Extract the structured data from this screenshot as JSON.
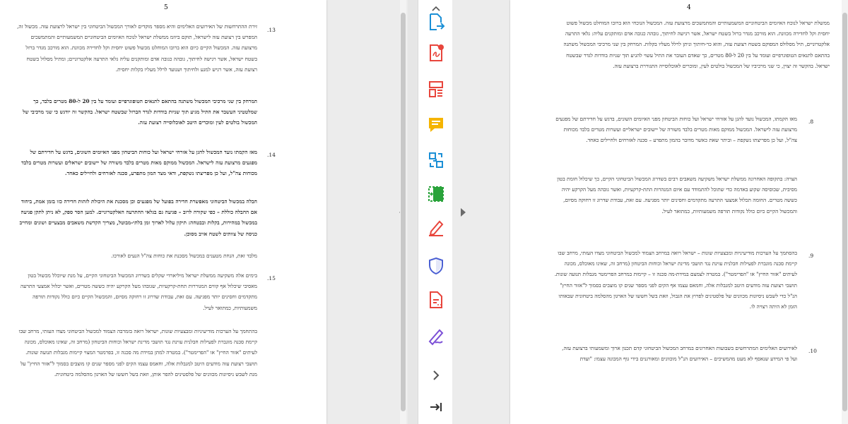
{
  "left_page": {
    "page_number": "5",
    "paragraphs": [
      {
        "num": ".13",
        "text": "זירת ההתרחשות של האירועים האלימים והיא מספר מוקדים לאורך המכשול הביטחוני בין ישראל לרצועת עזה. מכשול זה, המפרש בין רצועת עזה לישראל, תוקם ביוזמ ממשלת ישראל לנוכח האיומים הביטחוניים המשמעותיים והמתמשכים מרצועת עזה. המכשול הקיים כיום הוא ברובו המוחלט מכשול פשוט יחסית וקל לחדירה מכוונת. הוא מורכב מגדר ברזל בשטח ישראל, אשר רגישה לחיתוך, גובהה כגובה אדם ומותקנים עליה גלאי התרעה אלקטרוניים; ומתיל מסלול בשטח רצועת עזה, אשר רגיש למגע ולחיתוך ושנועד לרלל מעליו בקלות יחסית."
      },
      {
        "num": "",
        "text": "המרחק בין שני מרכיבי המכשול משתנה בהתאם לתנאים הטופוגרפיים ועומד על בין 20 ל-80 מטרים בלבד, כך שמלטטיני העשבר את התיל מגיע תוך שניות בודדות לגדר הברזל שבשטח ישראל. בהקשר זה יודגש כי שני מרכיבי של המכשול בולטים לעין ומוכרים היטב לאוכלוסייה רצועת עזה."
      },
      {
        "num": ".14",
        "text": "מאז הקמתו נועד המכשול להגן על אזרחי ישראל ועל כוחות הביטחון מפני האיומים השונים, בדגש על חדירתם של מפגעים מרצועת עזה לישראל. המכשול ממוקם מאות מטרים בלבד משורה של יישובים ישראלים ועשרות מטרים בלבד מכוחות צה\"ל, ועל כן מפריצתו נשקפת, ודאי מצד המון מתפרע, סכנה לאזרחים ולחיילים כאחד."
      },
      {
        "num": "",
        "text": "חבלה במכשול הביטחוני מאפשרת חדירה בפועל של מפגעים וכן מסכנת את היכולת לזהות חדירה כזו בזמן אמת, ביחוד אם החבלה כוללת – כפי שקורה לרוב – פגיעה גם בגלאי ההתרעה האלקטרוניים. למען הסר ספק, לא ניתן לתקן פגיעה במכשול במהירות, בקלות ובבטחה: תיקון עלול לארוך זמן בלתי-מבוטל, מצריך הקדשת משאבים מבצעיים ושונים ומחייב כניסה של צוותים לשטח אויב מסוכן."
      },
      {
        "num": "",
        "text": "מלבד זאת, הנחת מטענים במכשול מסכנת את כוחות צה\"ל הנעים לאורכו."
      },
      {
        "num": ".15",
        "text": "בימים אלה משקיעה ממשלת ישראל מיליארדי שקלים בשדרוג המכשול הביטחוני הקיים, על מנת שיוכלל מכשול בטון מאסיבי שיכלול אף קווים המגוררות תחת-קרקעיות, שגובהו מעל הקרקע יהיה כששה מטרים, ואשר יכלול אמצעי התרעה מתקדמים וחסינים יותר מפגיעה. עם זאת, עבודת שדרוג זו רחוקה מסיום, והמכשול הקיים כיום כולל נקודות תורפה משמעותיות, כמתואר לעיל."
      },
      {
        "num": "",
        "text": "בהתחמך על הערכות מודיעיניות ומבצעיות שונות, ישראל רואה בזמרבה הצמוד למכשול הביטחוני מצדו העזתי, מרחב שבו קיימת סכנה מוגברת לפעילות חבלנית עוינת נגד תושבי מדינת ישראל וכוחות הביטחון (מרחב זה, שאינו מאוכלס, מכונה לעיתים \"אזור החיץ\" או \"הפרימטר\"). במטרה למתן במידת מה סכנה זו, בפרמטר המצוי קיימות מגבלות תנועה שונות. תושבי רצועת עזה מודעים היטב למגבלות אלה, וחאמס עצמו הקים לפני מספר שנים קו מוצבים בסמוך ל\"אזור החיץ\" על מנת לשבש ניסיונות מכוונים של פלסטינים להפר אותן, וזאת בשל חששו של הארגון מהסלמה ביטחונית."
      }
    ]
  },
  "right_page": {
    "page_number": "4",
    "paragraphs": [
      {
        "num": "",
        "text": "ממשלת ישראל לנוכח האיומים הביטחוניים המשמעותיים והמתמשכים מרצועת עזה. המכשול הנוכחי הוא ברובו המוחלט מכשול פשוט יחסית וקל לחדירה מכוונת. הוא מורכב מגדר ברזל בשטח ישראל, אשר רגישה לחיתוך, גובהה כגובה אדם ומותקנים עליה: גלאי התרעה אלקטרוניים, תיל מסלולס המפוקם בשטח רצועת עזה, והוא כר-חיתוך וניתן לרלל מעליו בקלות. המרחק בין שני מרכיבי המכשול משתנה בהתאם לתנאים הטופוגרפיים ועומד על בין 20 ל-80 מטרים, כך שאדם העובר את התיל עשוי להגיע תוך שניות בודדות לגדר שבשטח ישראל. בהקשר זה יצוין, כי שני מרכיביו של המכשול בולטים לעין, ומוכרים לאוכלוסייה התגוררת ברצועת עזה."
      },
      {
        "num": ".8",
        "text": "מאז הקמתו, המכשול נועד להגן על אזרחי ישראל ועל כוחות הביטחון מפני האיומים השונים, בדגש על חדירתם של מפגעים מרצועת עזה לישראל. המכשול ממוקם מאות מטרים בלבד משורה של יישובים ישראליים ועשרות מטרים בלבד מכוחות צה\"ל, ועל כן מפריצתו נשקפת – וביתר שאת כאשר מדובר בהמון מתפרע – סכנה לאזרחים ולחיילים כאחד."
      },
      {
        "num": "",
        "text": "הצרה: בתקופה האחרונה ממשלת ישראל משקיעה משאבים רבים בשדרוג המכשול הביטחוני הקיים, כך שיכלול חומת בטון מסיבית, שכוסיסה שקוע באדמה כדי שתוכל להתמודד עם איום המנהרות התת-קרקעיות, ואשר גובהה מעל הקרקע יהיה כששה מטרים. החומה תכלול אמצעי התרעה מתקדמים וחסינים יותר מפגיעה. עם זאת, עבודת שדרוג זו רחוקה מסיום, והמכשול הקיים כיום כולל נקודות תורפה משמעותיות, כמתואר לעיל."
      },
      {
        "num": ".9",
        "text": "בהסתמך על הערכות מודיעיניות ומבצעיות שונות – ישראל רואה במרחב הצמוד למכשול הביטחוני מצדו העזתי, מרחב שבו קיימת סכנה מוגברת לפעילות חבלנית עוינת נגד תושבי מדינת ישראל וכוחות הביטחון (מרחב זה, שאינו מאוכלס, מכונה לעיתים \"אזור החיץ\" או \"הפרימטר\"). במטרה לצמצם במידת-מה סכנה זו – קיימות במרחב הפרימטר מגבלות תנועה שונות. תושבי רצועת עזה מודעים היטב למגבלות אלה, וחמאס עצמו אף הקים לפני מספר שנים קו מוצבים בסמוך ל\"אזור החיץ\" הנ\"ל כדי לשבש ניסיונות מכוונים של פלסטינים לפרוץ את הגבול, וזאת בשל חששו של הארגון מהסלמה ביטחונית שבאותו הזמן לא היתה רצויה לו."
      },
      {
        "num": ".10",
        "text": "לאירועים האלימים המתרחשים בשבועות האחרונים במרחב המכשול הביטחוני קדם תכנון ארוך ומשמעותי ברצועת עזה, ועל פי המידע שנאסף לא מעט מהמשיכים – האירועים הנ\"ל מוכוונים ומאורגנים בידי גוף המכונה עצמו: \"ועדת"
      }
    ]
  },
  "toolbar": {
    "tools": [
      {
        "name": "export-pdf-icon",
        "color": "#1a8fd6"
      },
      {
        "name": "create-pdf-icon",
        "color": "#e8453c"
      },
      {
        "name": "organize-pages-icon",
        "color": "#e8453c"
      },
      {
        "name": "comment-icon",
        "color": "#f5b400"
      },
      {
        "name": "combine-files-icon",
        "color": "#1a8fd6"
      },
      {
        "name": "compress-pdf-icon",
        "color": "#2aa33b"
      },
      {
        "name": "edit-pdf-icon",
        "color": "#e8453c"
      },
      {
        "name": "protect-icon",
        "color": "#4a5fd3"
      },
      {
        "name": "fill-sign-pdf-icon",
        "color": "#e8453c"
      },
      {
        "name": "signature-icon",
        "color": "#7b4fd6"
      }
    ]
  }
}
